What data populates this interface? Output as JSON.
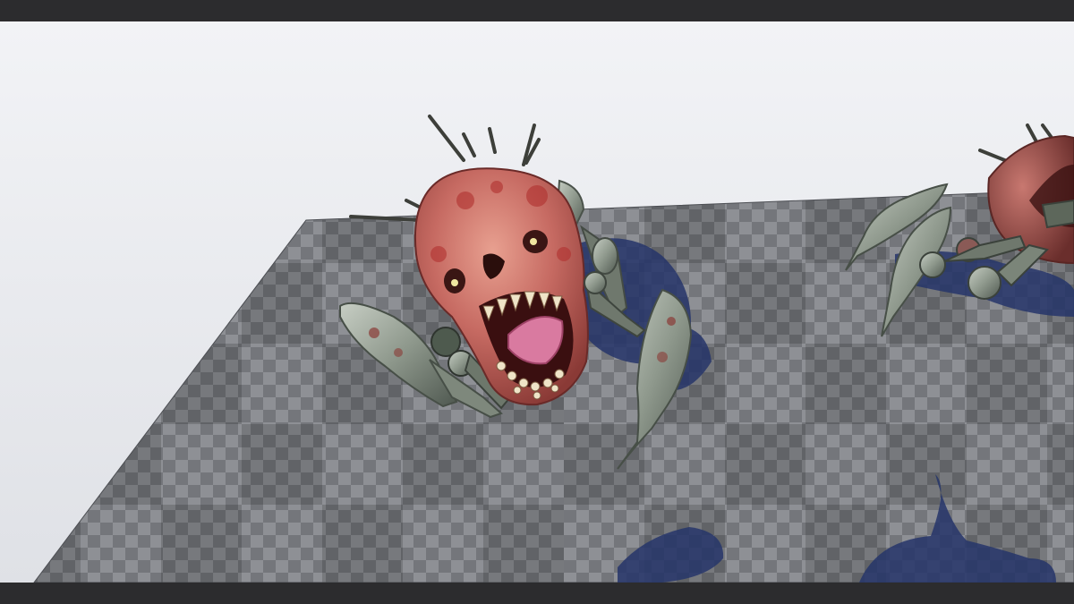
{
  "scene": {
    "type": "3d-viewport-preview",
    "subject": "skull-spider-creature",
    "sky_color": "#e9ebef",
    "floor_dark": "#55575d",
    "floor_light": "#8b8d92",
    "shadow_color": "#2a3a6e",
    "flesh_color": "#c9706a",
    "metal_color": "#8a9388"
  }
}
